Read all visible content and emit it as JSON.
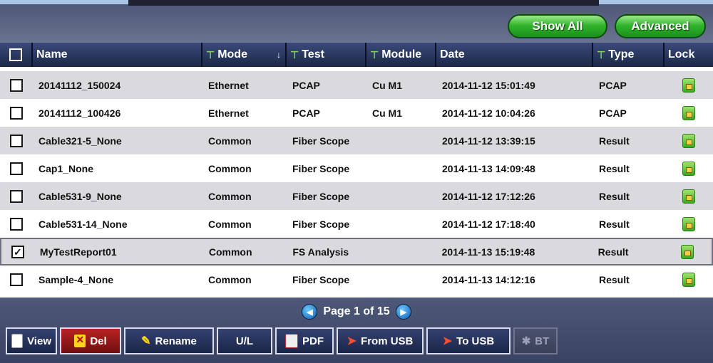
{
  "header": {
    "show_all": "Show All",
    "advanced": "Advanced"
  },
  "columns": [
    {
      "label": "Name"
    },
    {
      "label": "Mode"
    },
    {
      "label": "Test"
    },
    {
      "label": "Module"
    },
    {
      "label": "Date"
    },
    {
      "label": "Type"
    },
    {
      "label": "Lock"
    }
  ],
  "rows": [
    {
      "checked": false,
      "name": "20141112_150024",
      "mode": "Ethernet",
      "test": "PCAP",
      "module": "Cu M1",
      "date": "2014-11-12 15:01:49",
      "type": "PCAP"
    },
    {
      "checked": false,
      "name": "20141112_100426",
      "mode": "Ethernet",
      "test": "PCAP",
      "module": "Cu M1",
      "date": "2014-11-12 10:04:26",
      "type": "PCAP"
    },
    {
      "checked": false,
      "name": "Cable321-5_None",
      "mode": "Common",
      "test": "Fiber Scope",
      "module": "",
      "date": "2014-11-12 13:39:15",
      "type": "Result"
    },
    {
      "checked": false,
      "name": "Cap1_None",
      "mode": "Common",
      "test": "Fiber Scope",
      "module": "",
      "date": "2014-11-13 14:09:48",
      "type": "Result"
    },
    {
      "checked": false,
      "name": "Cable531-9_None",
      "mode": "Common",
      "test": "Fiber Scope",
      "module": "",
      "date": "2014-11-12 17:12:26",
      "type": "Result"
    },
    {
      "checked": false,
      "name": "Cable531-14_None",
      "mode": "Common",
      "test": "Fiber Scope",
      "module": "",
      "date": "2014-11-12 17:18:40",
      "type": "Result"
    },
    {
      "checked": true,
      "name": "MyTestReport01",
      "mode": "Common",
      "test": "FS Analysis",
      "module": "",
      "date": "2014-11-13 15:19:48",
      "type": "Result"
    },
    {
      "checked": false,
      "name": "Sample-4_None",
      "mode": "Common",
      "test": "Fiber Scope",
      "module": "",
      "date": "2014-11-13 14:12:16",
      "type": "Result"
    }
  ],
  "pager": {
    "text": "Page 1 of 15"
  },
  "toolbar": {
    "view": "View",
    "del": "Del",
    "rename": "Rename",
    "ul": "U/L",
    "pdf": "PDF",
    "from_usb": "From USB",
    "to_usb": "To USB",
    "bt": "BT"
  },
  "colors": {
    "accent_green": "#32b52d",
    "header_navy": "#1c2747",
    "delete_red": "#b82222"
  }
}
